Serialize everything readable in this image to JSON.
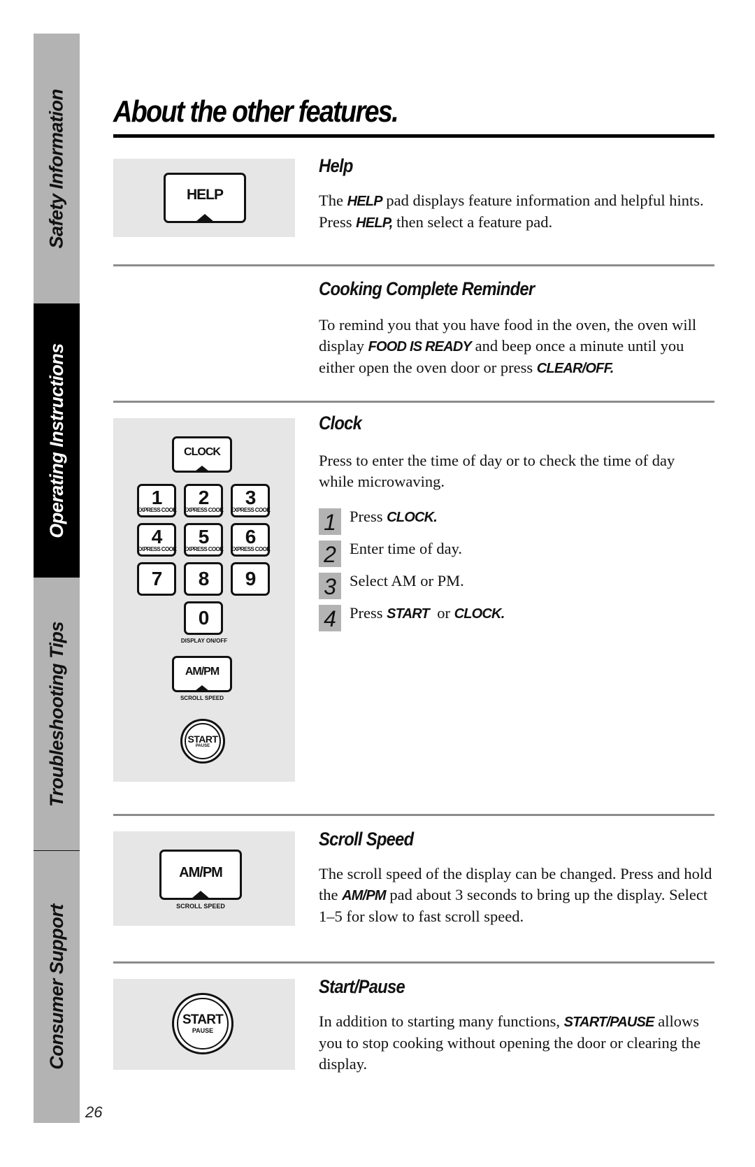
{
  "sidebar": {
    "tabs": [
      {
        "label": "Safety Information",
        "active": false
      },
      {
        "label": "Operating Instructions",
        "active": true
      },
      {
        "label": "Troubleshooting Tips",
        "active": false
      },
      {
        "label": "Consumer Support",
        "active": false
      }
    ],
    "page_number": "26"
  },
  "page": {
    "title": "About the other features."
  },
  "help": {
    "heading": "Help",
    "pad_label": "HELP",
    "body": {
      "t1": "The ",
      "k1": "HELP",
      "t2": " pad displays feature information and helpful hints. Press ",
      "k2": "HELP,",
      "t3": " then select a feature pad."
    }
  },
  "reminder": {
    "heading": "Cooking Complete Reminder",
    "body": {
      "t1": "To remind you that you have food in the oven, the oven will display ",
      "k1": "FOOD IS READY",
      "t2": " and beep once a minute until you either open the oven door or press ",
      "k2": "CLEAR/OFF."
    }
  },
  "clock": {
    "heading": "Clock",
    "body": "Press to enter the time of day or to check the time of day while microwaving.",
    "keypad": {
      "clock_label": "CLOCK",
      "express_label": "EXPRESS COOK",
      "digits_express": [
        "1",
        "2",
        "3",
        "4",
        "5",
        "6"
      ],
      "digits_plain": [
        "7",
        "8",
        "9"
      ],
      "zero": "0",
      "zero_sublabel": "DISPLAY ON/OFF",
      "ampm_label": "AM/PM",
      "ampm_sublabel": "SCROLL SPEED",
      "start_label": "START",
      "pause_label": "PAUSE"
    },
    "steps": [
      {
        "num": "1",
        "t1": "Press ",
        "k1": "CLOCK.",
        "t2": "",
        "k2": ""
      },
      {
        "num": "2",
        "t1": "Enter time of day.",
        "k1": "",
        "t2": "",
        "k2": ""
      },
      {
        "num": "3",
        "t1": "Select AM or PM.",
        "k1": "",
        "t2": "",
        "k2": ""
      },
      {
        "num": "4",
        "t1": "Press ",
        "k1": "START",
        "t2": "  or ",
        "k2": "CLOCK."
      }
    ]
  },
  "scroll": {
    "heading": "Scroll Speed",
    "pad_label": "AM/PM",
    "pad_sublabel": "SCROLL SPEED",
    "body": {
      "t1": "The scroll speed of the display can be changed. Press and hold the ",
      "k1": "AM/PM",
      "t2": "  pad about 3 seconds to bring up the display. Select 1–5 for slow to fast scroll speed."
    }
  },
  "startpause": {
    "heading": "Start/Pause",
    "pad_label": "START",
    "pad_sublabel": "PAUSE",
    "body": {
      "t1": "In addition to starting many functions, ",
      "k1": "START/PAUSE",
      "t2": " allows you to stop cooking without opening the door or clearing the display."
    }
  }
}
